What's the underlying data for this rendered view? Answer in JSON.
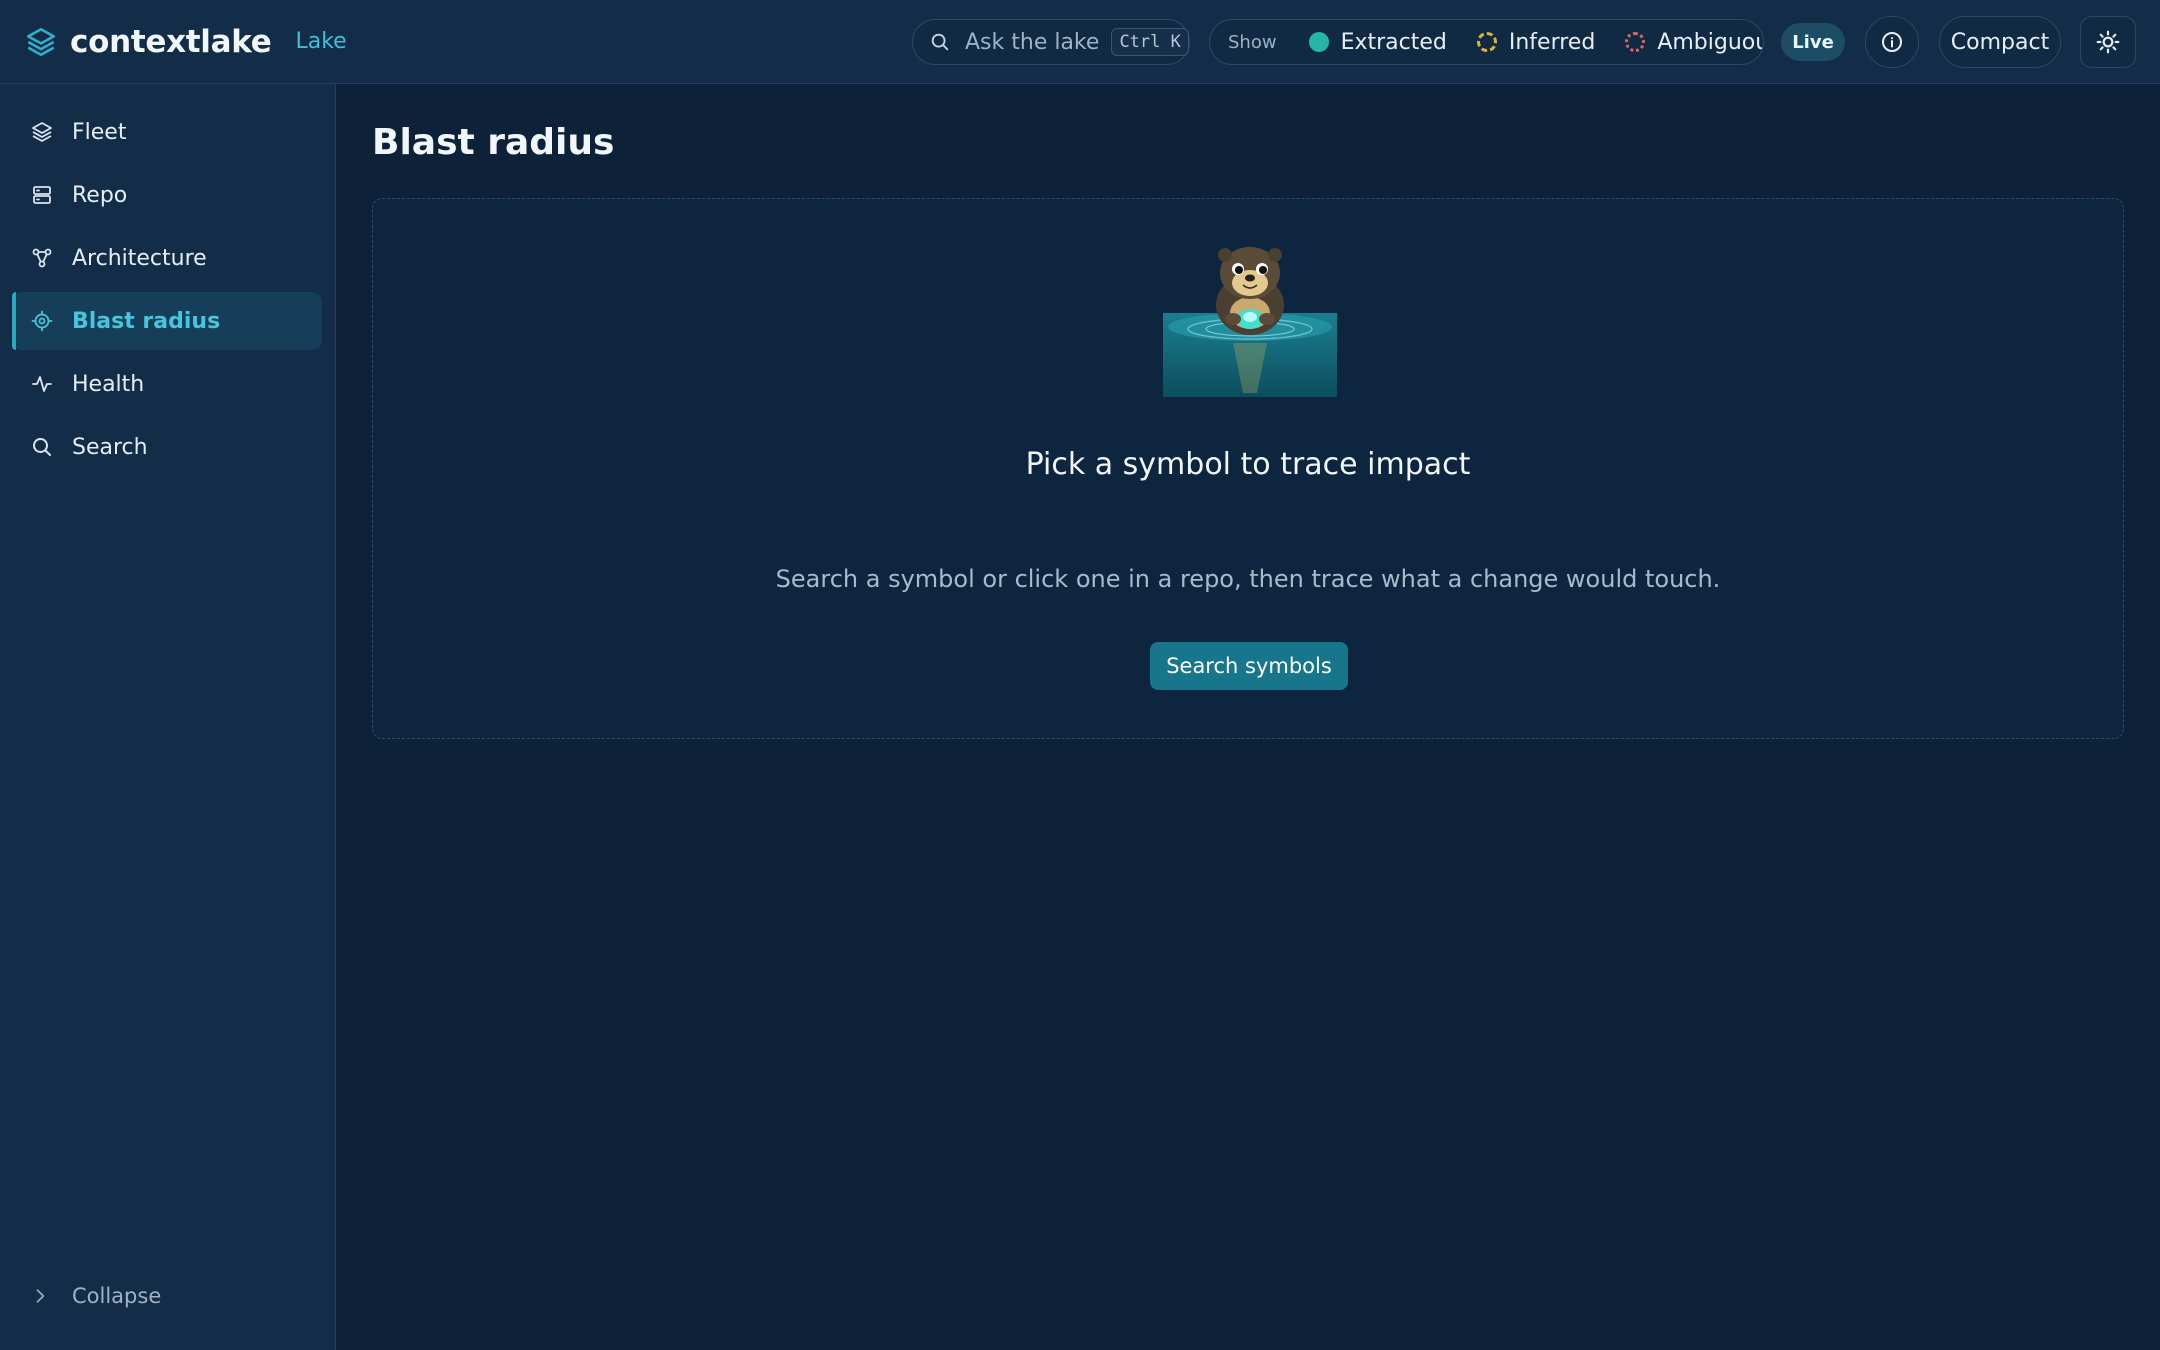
{
  "brand": {
    "name": "contextlake",
    "tag": "Lake",
    "icon": "layers-icon"
  },
  "topbar": {
    "search": {
      "placeholder": "Ask the lake",
      "shortcut": "Ctrl K"
    },
    "filters": {
      "label": "Show",
      "items": [
        {
          "label": "Extracted",
          "style": "solid",
          "color": "#26b6a5"
        },
        {
          "label": "Inferred",
          "style": "dashed",
          "color": "#e0b43a"
        },
        {
          "label": "Ambiguous",
          "style": "dotted",
          "color": "#d96a5c"
        }
      ]
    },
    "live_label": "Live",
    "compact_label": "Compact"
  },
  "sidebar": {
    "items": [
      {
        "label": "Fleet",
        "icon": "layers-icon"
      },
      {
        "label": "Repo",
        "icon": "server-icon"
      },
      {
        "label": "Architecture",
        "icon": "graph-icon"
      },
      {
        "label": "Blast radius",
        "icon": "target-icon",
        "active": true
      },
      {
        "label": "Health",
        "icon": "activity-icon"
      },
      {
        "label": "Search",
        "icon": "search-icon"
      }
    ],
    "collapse_label": "Collapse"
  },
  "main": {
    "title": "Blast radius",
    "empty_state": {
      "title": "Pick a symbol to trace impact",
      "description": "Search a symbol or click one in a repo, then trace what a change would touch.",
      "button_label": "Search symbols"
    }
  },
  "colors": {
    "accent": "#3fc0d6",
    "background": "#0d2238",
    "panel": "#132d49",
    "primary_button": "#17768c"
  }
}
